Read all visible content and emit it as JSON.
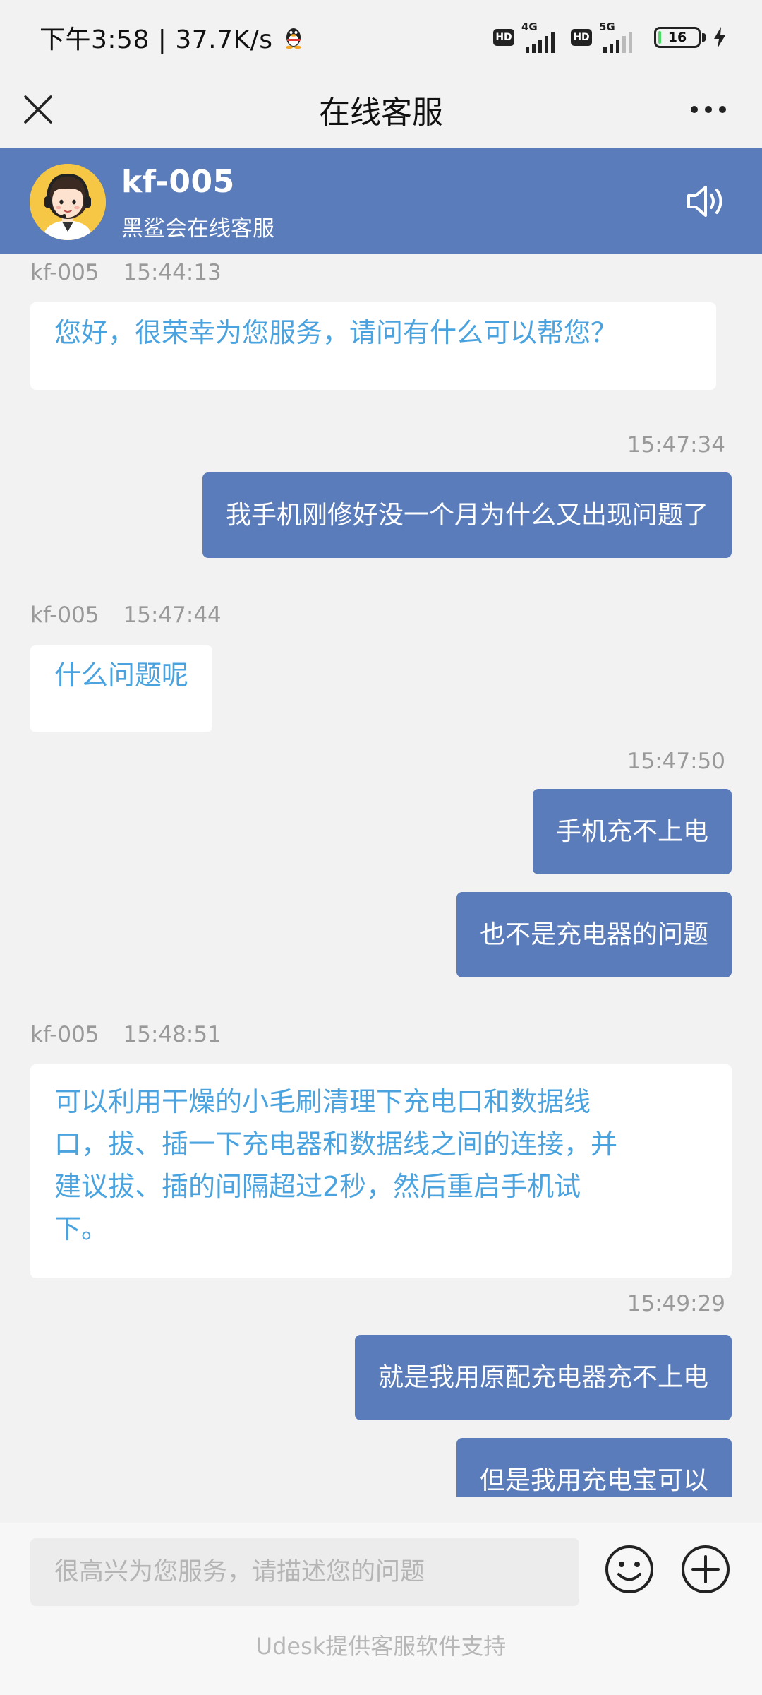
{
  "status_bar": {
    "time_speed": "下午3:58 | 37.7K/s",
    "hd_badge_1": "HD",
    "net_1": "4G",
    "hd_badge_2": "HD",
    "net_2": "5G",
    "battery_level": "16",
    "battery_fraction": 0.16
  },
  "title_bar": {
    "title": "在线客服",
    "close_icon": "close-icon",
    "more_icon": "more-icon"
  },
  "agent": {
    "name": "kf-005",
    "subtitle": "黑鲨会在线客服",
    "speaker_icon": "speaker-icon"
  },
  "messages": [
    {
      "from": "agent",
      "sender": "kf-005",
      "time": "15:44:13",
      "text": "您好，很荣幸为您服务，请问有什么可以帮您？"
    },
    {
      "from": "user",
      "time": "15:47:34",
      "text": "我手机刚修好没一个月为什么又出现问题了"
    },
    {
      "from": "agent",
      "sender": "kf-005",
      "time": "15:47:44",
      "text": "什么问题呢"
    },
    {
      "from": "user",
      "time": "15:47:50",
      "text": "手机充不上电"
    },
    {
      "from": "user",
      "text": "也不是充电器的问题"
    },
    {
      "from": "agent",
      "sender": "kf-005",
      "time": "15:48:51",
      "text_lines": [
        "可以利用干燥的小毛刷清理下充电口和数据线",
        "口，拔、插一下充电器和数据线之间的连接，并",
        "建议拔、插的间隔超过2秒，然后重启手机试",
        "下。"
      ]
    },
    {
      "from": "user",
      "time": "15:49:29",
      "text": "就是我用原配充电器充不上电"
    },
    {
      "from": "user",
      "text": "但是我用充电宝可以"
    }
  ],
  "input": {
    "placeholder": "很高兴为您服务，请描述您的问题",
    "value": ""
  },
  "footer": {
    "credit": "Udesk提供客服软件支持"
  },
  "colors": {
    "accent": "#5b7cba",
    "agent_text": "#4aa3df",
    "background": "#f2f2f2"
  }
}
